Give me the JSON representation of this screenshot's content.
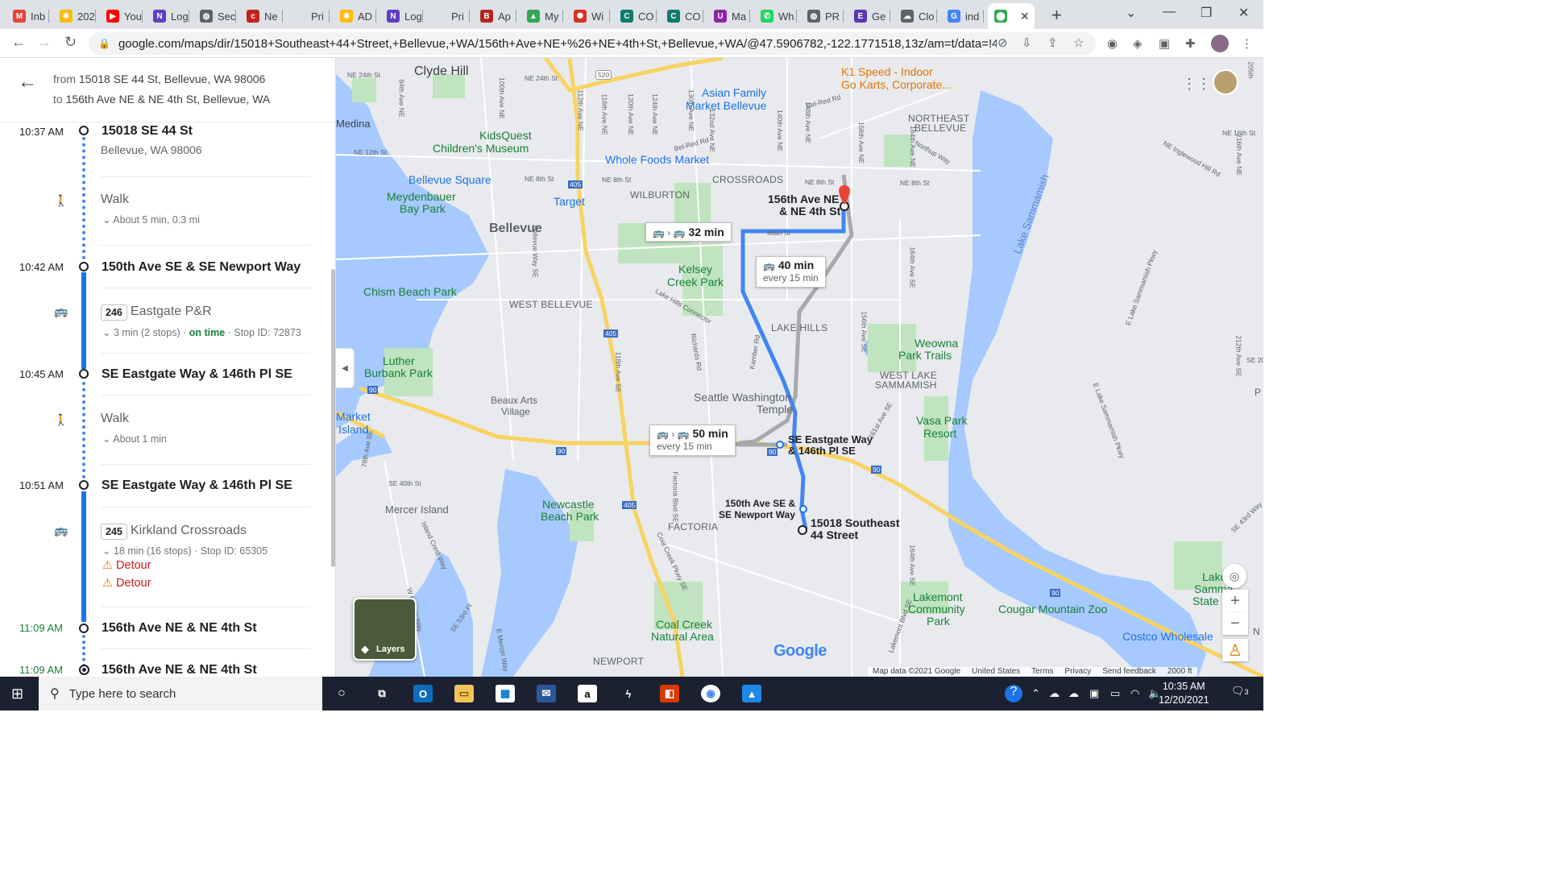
{
  "browser": {
    "tabs": [
      {
        "label": "Inb",
        "icon": "gmail-icon",
        "color": "#ea4335",
        "glyph": "M"
      },
      {
        "label": "202",
        "icon": "photos-icon",
        "color": "#fbbc04",
        "glyph": "✱"
      },
      {
        "label": "You",
        "icon": "youtube-icon",
        "color": "#ff0000",
        "glyph": "▶"
      },
      {
        "label": "Log",
        "icon": "app-icon",
        "color": "#5f3dc4",
        "glyph": "N"
      },
      {
        "label": "Sec",
        "icon": "globe-icon",
        "color": "#5f6368",
        "glyph": "◍"
      },
      {
        "label": "Ne",
        "icon": "cisco-icon",
        "color": "#c5221f",
        "glyph": "c"
      },
      {
        "label": "Pri",
        "icon": "blank-page-icon",
        "color": "#dee1e6",
        "glyph": ""
      },
      {
        "label": "AD",
        "icon": "photos-icon",
        "color": "#fbbc04",
        "glyph": "✱"
      },
      {
        "label": "Log",
        "icon": "app-icon",
        "color": "#5f3dc4",
        "glyph": "N"
      },
      {
        "label": "Pri",
        "icon": "blank-page-icon",
        "color": "#dee1e6",
        "glyph": ""
      },
      {
        "label": "Ap",
        "icon": "shield-red-icon",
        "color": "#b3261e",
        "glyph": "B"
      },
      {
        "label": "My",
        "icon": "drive-icon",
        "color": "#34a853",
        "glyph": "▲"
      },
      {
        "label": "Wi",
        "icon": "settings-red-icon",
        "color": "#d93025",
        "glyph": "✺"
      },
      {
        "label": "CO",
        "icon": "teams-icon",
        "color": "#0f7b6c",
        "glyph": "C"
      },
      {
        "label": "CO",
        "icon": "teams-icon",
        "color": "#0f7b6c",
        "glyph": "C"
      },
      {
        "label": "Ma",
        "icon": "purple-circle-icon",
        "color": "#8e24aa",
        "glyph": "U"
      },
      {
        "label": "Wh",
        "icon": "whatsapp-icon",
        "color": "#25d366",
        "glyph": "✆"
      },
      {
        "label": "PR",
        "icon": "globe-icon",
        "color": "#5f6368",
        "glyph": "◍"
      },
      {
        "label": "Ge",
        "icon": "docs-icon",
        "color": "#5e35b1",
        "glyph": "E"
      },
      {
        "label": "Clo",
        "icon": "cloud-icon",
        "color": "#5f6368",
        "glyph": "☁"
      },
      {
        "label": "ind",
        "icon": "google-icon",
        "color": "#4285f4",
        "glyph": "G"
      },
      {
        "label": "",
        "icon": "maps-icon",
        "color": "#34a853",
        "glyph": "⬤",
        "active": true
      }
    ],
    "url": "google.com/maps/dir/15018+Southeast+44+Street,+Bellevue,+WA/156th+Ave+NE+%26+NE+4th+St,+Bellevue,+WA/@47.5906782,-122.1771518,13z/am=t/data=!4m1..."
  },
  "directions": {
    "from_prefix": "from",
    "from": "15018 SE 44 St, Bellevue, WA 98006",
    "to_prefix": "to",
    "to": "156th Ave NE & NE 4th St, Bellevue, WA",
    "steps": {
      "s1_time": "10:37 AM",
      "s1_name": "15018 SE 44 St",
      "s1_sub": "Bellevue, WA 98006",
      "walk1_label": "Walk",
      "walk1_detail": "About 5 min, 0.3 mi",
      "s2_time": "10:42 AM",
      "s2_name": "150th Ave SE & SE Newport Way",
      "bus1_route": "246",
      "bus1_dest": "Eastgate P&R",
      "bus1_detail": "3 min (2 stops)",
      "bus1_dot1": "·",
      "bus1_status": "on time",
      "bus1_dot2": "·",
      "bus1_stop": "Stop ID: 72873",
      "s3_time": "10:45 AM",
      "s3_name": "SE Eastgate Way & 146th Pl SE",
      "walk2_label": "Walk",
      "walk2_detail": "About 1 min",
      "s4_time": "10:51 AM",
      "s4_name": "SE Eastgate Way & 146th Pl SE",
      "bus2_route": "245",
      "bus2_dest": "Kirkland Crossroads",
      "bus2_detail": "18 min (16 stops)",
      "bus2_dot": "·",
      "bus2_stop": "Stop ID: 65305",
      "detour1": "Detour",
      "detour2": "Detour",
      "s5_time": "11:09 AM",
      "s5_name": "156th Ave NE & NE 4th St",
      "s6_time": "11:09 AM",
      "s6_name": "156th Ave NE & NE 4th St"
    }
  },
  "map": {
    "labels": {
      "clyde_hill": "Clyde Hill",
      "medina": "Medina",
      "kidsquest": "KidsQuest\nChildren's Museum",
      "kidsquest_1": "KidsQuest",
      "kidsquest_2": "Children's Museum",
      "whole_foods": "Whole Foods Market",
      "bellevue_square": "Bellevue Square",
      "meydenbauer_1": "Meydenbauer",
      "meydenbauer_2": "Bay Park",
      "target": "Target",
      "bellevue": "Bellevue",
      "asian_family_1": "Asian Family",
      "asian_family_2": "Market Bellevue",
      "k1_speed_1": "K1 Speed - Indoor",
      "k1_speed_2": "Go Karts, Corporate...",
      "ne_bellevue_1": "NORTHEAST",
      "ne_bellevue_2": "BELLEVUE",
      "crossroads": "CROSSROADS",
      "wilburton": "WILBURTON",
      "kelsey_1": "Kelsey",
      "kelsey_2": "Creek Park",
      "chism": "Chism Beach Park",
      "west_bellevue": "WEST BELLEVUE",
      "lake_hills": "LAKE HILLS",
      "weowna_1": "Weowna",
      "weowna_2": "Park Trails",
      "west_lake_1": "WEST LAKE",
      "west_lake_2": "SAMMAMISH",
      "luther_1": "Luther",
      "luther_2": "Burbank Park",
      "market_1": "Market",
      "market_2": "Island",
      "beaux_1": "Beaux Arts",
      "beaux_2": "Village",
      "temple_1": "Seattle Washington",
      "temple_2": "Temple",
      "vasa_1": "Vasa Park",
      "vasa_2": "Resort",
      "lake_sammamish": "Lake Sammamish",
      "mercer_island": "Mercer Island",
      "newcastle_1": "Newcastle",
      "newcastle_2": "Beach Park",
      "factoria": "FACTORIA",
      "lakemont_1": "Lakemont",
      "lakemont_2": "Community",
      "lakemont_3": "Park",
      "cougar": "Cougar Mountain Zoo",
      "coal_creek_1": "Coal Creek",
      "coal_creek_2": "Natural Area",
      "newport": "NEWPORT",
      "costco": "Costco Wholesale",
      "lake_samm_sp_1": "Lake",
      "lake_samm_sp_2": "Samma",
      "lake_samm_sp_3": "State P",
      "n_label": "N",
      "p_label": "P"
    },
    "stops": {
      "dest_1": "156th Ave NE",
      "dest_2": "& NE 4th St",
      "eastgate_1": "SE Eastgate Way",
      "eastgate_2": "& 146th Pl SE",
      "newport_1": "150th Ave SE &",
      "newport_2": "SE Newport Way",
      "origin_1": "15018 Southeast",
      "origin_2": "44 Street"
    },
    "cards": {
      "c1_dur": "32 min",
      "c2_dur": "40 min",
      "c2_freq": "every 15 min",
      "c3_dur": "50 min",
      "c3_freq": "every 15 min"
    },
    "road_labels": {
      "ne24": "NE 24th St",
      "ne24b": "NE 24th St",
      "ne12": "NE 12th St",
      "ne8a": "NE 8th St",
      "ne8b": "NE 8th St",
      "ne8c": "NE 8th St",
      "ne8d": "NE 8th St",
      "i405a": "405",
      "i405b": "405",
      "i405c": "405",
      "i90a": "90",
      "i90b": "90",
      "i90c": "90",
      "i90d": "90",
      "i90e": "90",
      "sr520": "520",
      "main": "Main St",
      "bel_red": "Bel-Red Rd",
      "bel_red2": "Bel-Red Rd",
      "northup": "Northup Way",
      "lake_hills_conn": "Lake Hills Connector",
      "richards": "Richards Rd",
      "kamber": "Kamber Rd",
      "se40": "SE 40th St",
      "coal_creek_pkwy": "Coal Creek Pkwy SE",
      "factoria_blvd": "Factoria Blvd SE",
      "ne16": "NE 16th St",
      "ne_inglewood": "NE Inglewood Hill Rd",
      "e_lake_pkwy": "E Lake Sammamish Pkwy",
      "se43": "SE 43rd Way",
      "lakemont_blvd": "Lakemont Blvd SE",
      "av84": "84th Ave NE",
      "av100": "100th Ave NE",
      "av112": "112th Ave NE",
      "av116": "116th Ave NE",
      "av120": "120th Ave NE",
      "av124": "124th Ave NE",
      "av130": "130th Ave NE",
      "av132": "132nd Ave NE",
      "av140": "140th Ave NE",
      "av148": "148th Ave NE",
      "av156": "156th Ave NE",
      "av164": "164th Ave NE",
      "av164s": "164th Ave SE",
      "av156s": "156th Ave SE",
      "av116s": "116th Ave SE",
      "bellevue_way": "Bellevue Way SE",
      "av118": "118th Ave SE",
      "av78": "78th Ave SE",
      "w_mercer": "W Mercer Way",
      "e_mercer": "E Mercer Way",
      "island_crest": "Island Crest Way",
      "av161": "161st Ave SE",
      "av212": "212th Ave SE",
      "av216": "216th Ave NE",
      "av205": "205th",
      "av164s2": "164th Ave SE",
      "st53": "SE 53rd Pl",
      "e_lake_pkwy2": "E Lake Sammamish Pkwy",
      "ne20": "NE 20th",
      "se20": "SE 20t"
    },
    "controls": {
      "layers": "Layers",
      "zoom_in": "+",
      "zoom_out": "−"
    },
    "footer": {
      "map_data": "Map data ©2021 Google",
      "country": "United States",
      "terms": "Terms",
      "privacy": "Privacy",
      "feedback": "Send feedback",
      "scale": "2000 ft"
    },
    "google_logo": "Google",
    "colors": {
      "route_primary": "#4285f4",
      "route_alt": "#a7a9ac",
      "highway": "#f8d363",
      "water": "#a6c9ff",
      "park": "#bfe4bf"
    }
  },
  "taskbar": {
    "search_placeholder": "Type here to search",
    "time": "10:35 AM",
    "date": "12/20/2021",
    "notification_count": "3"
  }
}
